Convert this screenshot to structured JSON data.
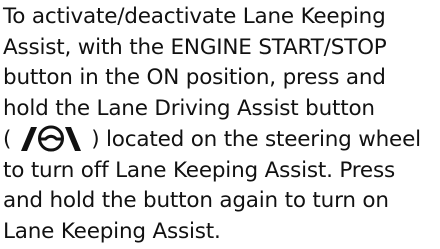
{
  "body": {
    "lines": [
      "To activate/deactivate Lane Keeping",
      "Assist, with the ENGINE START/STOP",
      "button in the ON position, press and",
      "hold the Lane Driving Assist button"
    ],
    "icon_line": {
      "open_paren": "(",
      "icon": "lane-driving-assist-steering-wheel-icon",
      "after_icon": ") located on the steering wheel"
    },
    "lines_after": [
      "to turn off Lane Keeping Assist. Press",
      "and hold the button again to turn on",
      "Lane Keeping Assist."
    ]
  },
  "colors": {
    "text": "#111111",
    "background": "#ffffff"
  }
}
